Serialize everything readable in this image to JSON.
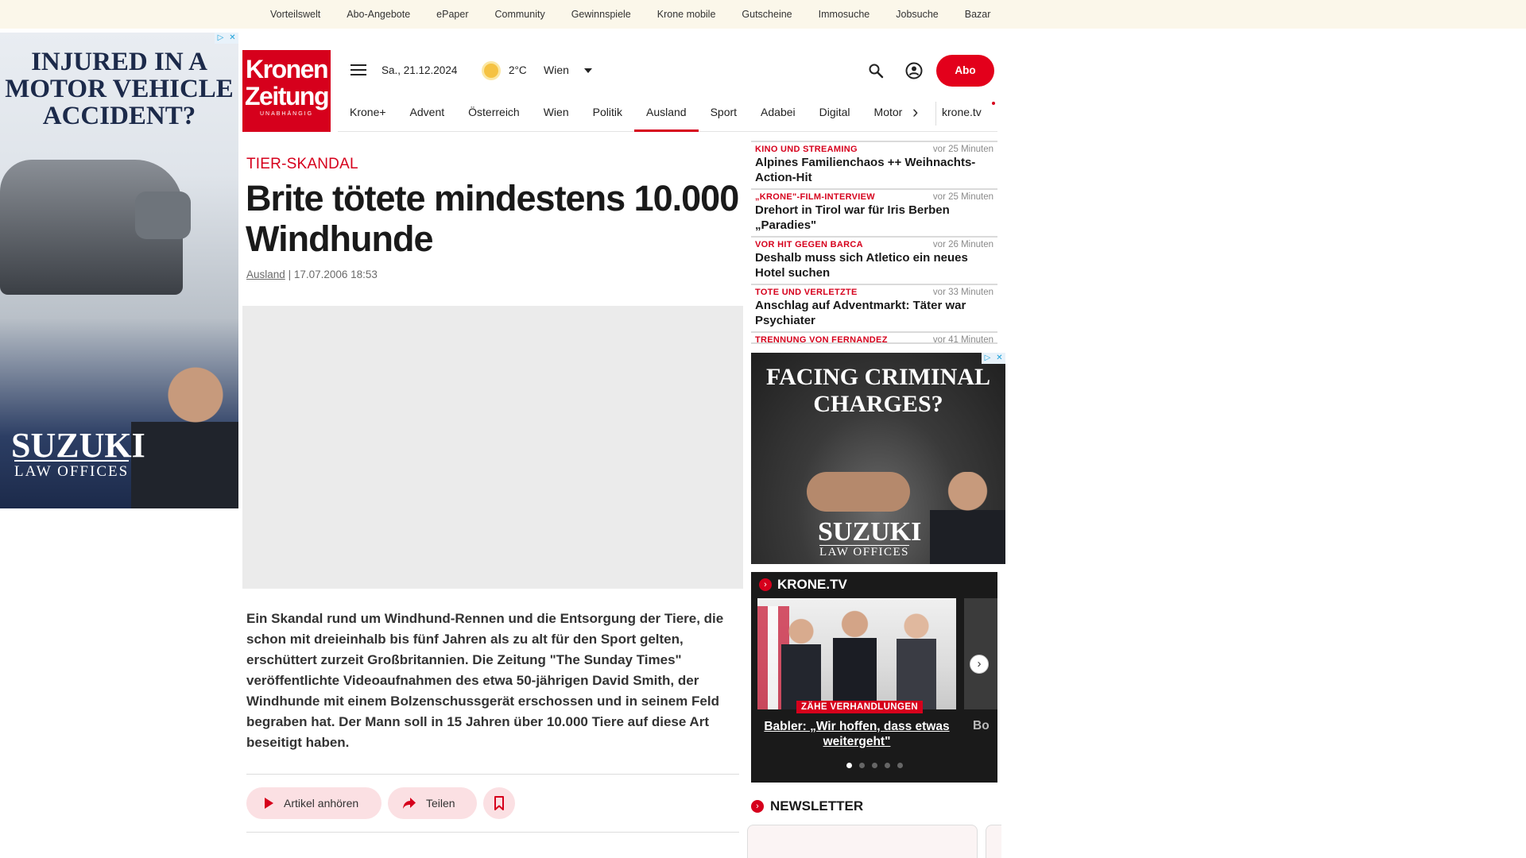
{
  "topbar": {
    "links": [
      "Vorteilswelt",
      "Abo-Angebote",
      "ePaper",
      "Community",
      "Gewinnspiele",
      "Krone mobile",
      "Gutscheine",
      "Immosuche",
      "Jobsuche",
      "Bazar"
    ]
  },
  "ad_left": {
    "headline": "INJURED IN A MOTOR VEHICLE ACCIDENT?",
    "brand": "SUZUKI",
    "brand_sub": "LAW OFFICES"
  },
  "header": {
    "logo_line1": "Kronen",
    "logo_line2": "Zeitung",
    "logo_tagline": "UNABHÄNGIG",
    "date": "Sa., 21.12.2024",
    "temperature": "2°C",
    "city": "Wien",
    "abo_label": "Abo"
  },
  "nav": {
    "items": [
      "Krone+",
      "Advent",
      "Österreich",
      "Wien",
      "Politik",
      "Ausland",
      "Sport",
      "Adabei",
      "Digital",
      "Motor"
    ],
    "active": "Ausland",
    "kronetv": "krone.tv"
  },
  "article": {
    "kicker": "TIER-SKANDAL",
    "headline": "Brite tötete mindestens 10.000 Windhunde",
    "section": "Ausland",
    "separator": "|",
    "timestamp": "17.07.2006 18:53",
    "lead": "Ein Skandal rund um Windhund-Rennen und die Entsorgung der Tiere, die schon mit dreieinhalb bis fünf Jahren als zu alt für den Sport gelten, erschüttert zurzeit Großbritannien. Die Zeitung \"The Sunday Times\" veröffentlichte Videoaufnahmen des etwa 50-jährigen David Smith, der Windhunde mit einem Bolzenschussgerät erschossen und in seinem Feld begraben hat. Der Mann soll in 15 Jahren über 10.000 Tiere auf diese Art beseitigt haben.",
    "listen_label": "Artikel anhören",
    "share_label": "Teilen"
  },
  "news": [
    {
      "category": "KINO UND STREAMING",
      "time": "vor 25 Minuten",
      "title": "Alpines Familienchaos ++ Weihnachts-Action-Hit"
    },
    {
      "category": "„KRONE\"-FILM-INTERVIEW",
      "time": "vor 25 Minuten",
      "title": "Drehort in Tirol war für Iris Berben „Paradies\""
    },
    {
      "category": "VOR HIT GEGEN BARCA",
      "time": "vor 26 Minuten",
      "title": "Deshalb muss sich Atletico ein neues Hotel suchen"
    },
    {
      "category": "TOTE UND VERLETZTE",
      "time": "vor 33 Minuten",
      "title": "Anschlag auf Adventmarkt: Täter war Psychiater"
    },
    {
      "category": "TRENNUNG VON FERNANDEZ",
      "time": "vor 41 Minuten",
      "title": ""
    }
  ],
  "ad_right": {
    "headline": "FACING CRIMINAL CHARGES?",
    "brand": "SUZUKI",
    "brand_sub": "LAW OFFICES"
  },
  "kronetv": {
    "title": "KRONE.TV",
    "badge": "ZÄHE VERHANDLUNGEN",
    "caption": "Babler: „Wir hoffen, dass etwas weitergeht\"",
    "next_caption": "Bo",
    "slide_count": 5,
    "active_slide": 1
  },
  "newsletter": {
    "title": "NEWSLETTER"
  }
}
